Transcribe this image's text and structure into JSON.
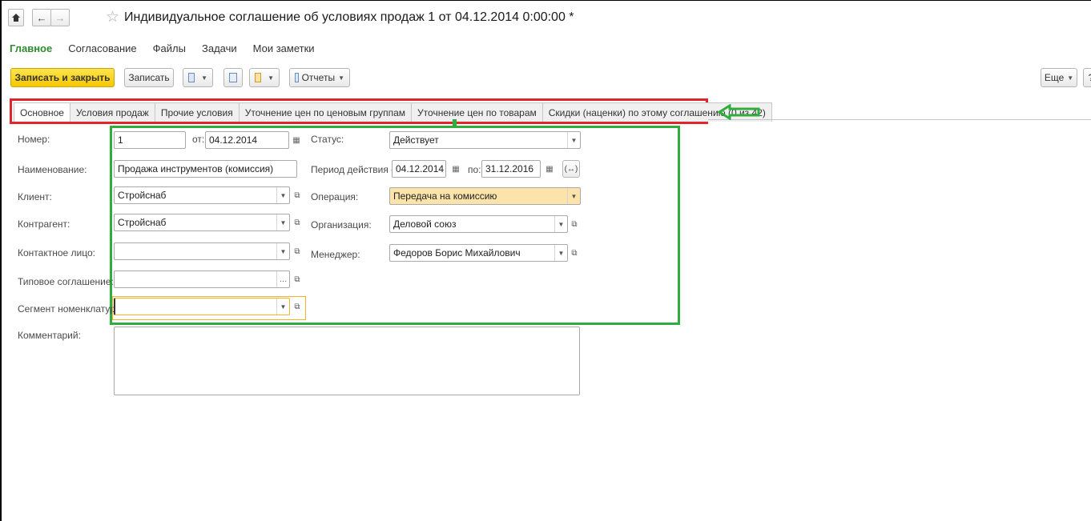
{
  "window": {
    "title": "Индивидуальное соглашение об условиях продаж 1 от 04.12.2014 0:00:00 *"
  },
  "nav": {
    "home_icon": "home-icon",
    "back_icon": "arrow-left-icon",
    "forward_icon": "arrow-right-icon",
    "favorite_icon": "star-icon",
    "sections": [
      "Главное",
      "Согласование",
      "Файлы",
      "Задачи",
      "Мои заметки"
    ]
  },
  "toolbar": {
    "save_close": "Записать и закрыть",
    "save": "Записать",
    "reports": "Отчеты",
    "more": "Еще",
    "help": "?"
  },
  "tabs": [
    "Основное",
    "Условия продаж",
    "Прочие условия",
    "Уточнение цен по ценовым группам",
    "Уточнение цен по товарам",
    "Скидки (наценки) по этому соглашению (0 из 42)"
  ],
  "form": {
    "number_label": "Номер:",
    "number_value": "1",
    "date_from_label": "от:",
    "date_value": "04.12.2014",
    "status_label": "Статус:",
    "status_value": "Действует",
    "name_label": "Наименование:",
    "name_value": "Продажа инструментов (комиссия)",
    "period_label": "Период действия с:",
    "period_from": "04.12.2014",
    "period_to_label": "по:",
    "period_to": "31.12.2016",
    "client_label": "Клиент:",
    "client_value": "Стройснаб",
    "operation_label": "Операция:",
    "operation_value": "Передача на комиссию",
    "counterparty_label": "Контрагент:",
    "counterparty_value": "Стройснаб",
    "organization_label": "Организация:",
    "organization_value": "Деловой союз",
    "contact_label": "Контактное лицо:",
    "contact_value": "",
    "manager_label": "Менеджер:",
    "manager_value": "Федоров Борис Михайлович",
    "typical_label": "Типовое соглашение:",
    "typical_value": "",
    "segment_label": "Сегмент номенклатуры:",
    "segment_value": "",
    "comment_label": "Комментарий:",
    "comment_value": ""
  },
  "colors": {
    "primary_button": "#f5c700",
    "active_section": "#2e8b2e",
    "tabs_highlight": "#e0262b",
    "fields_highlight": "#2fae3d",
    "operation_field": "#fbe3a9"
  }
}
